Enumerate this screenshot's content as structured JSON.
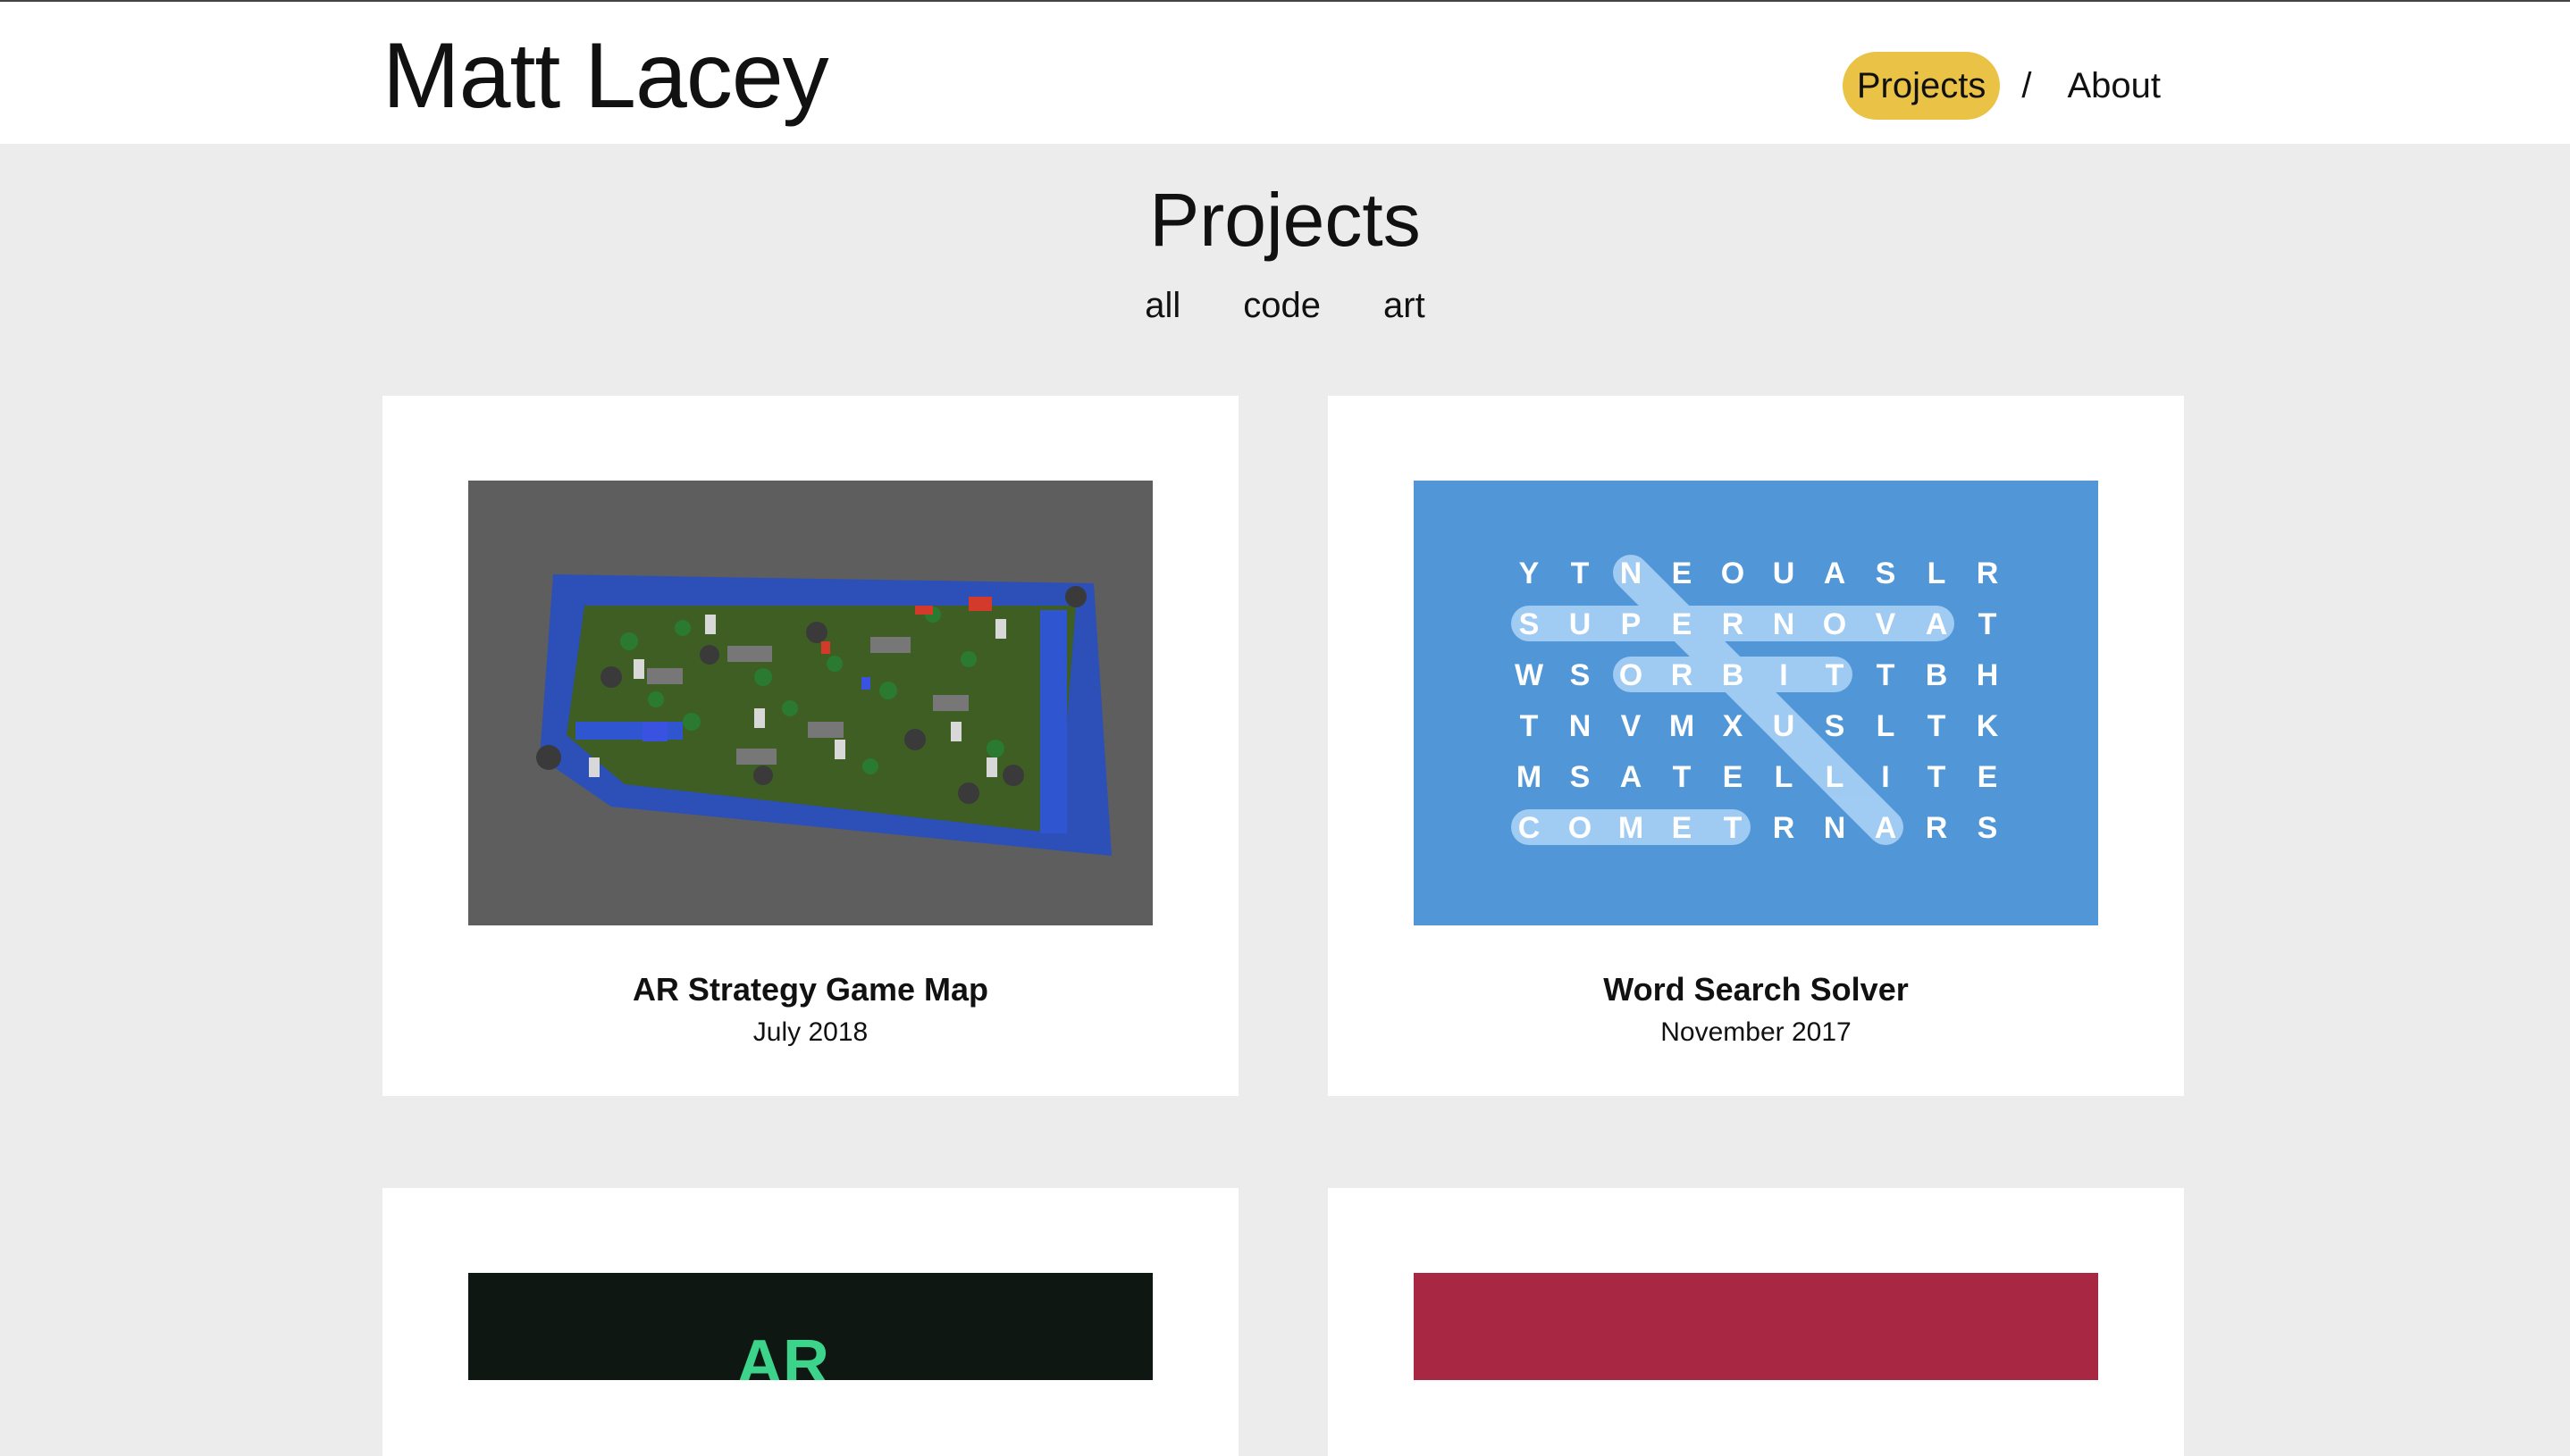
{
  "site": {
    "title": "Matt Lacey"
  },
  "nav": {
    "items": [
      {
        "label": "Projects",
        "active": true
      },
      {
        "label": "About",
        "active": false
      }
    ],
    "separator": "/"
  },
  "page": {
    "title": "Projects"
  },
  "filters": [
    "all",
    "code",
    "art"
  ],
  "projects": [
    {
      "title": "AR Strategy Game Map",
      "date": "July 2018",
      "thumb_icon": "ar-strategy-map-image"
    },
    {
      "title": "Word Search Solver",
      "date": "November 2017",
      "thumb_icon": "word-search-grid-image"
    },
    {
      "title": "",
      "date": "",
      "thumb_icon": "dark-ar-project-image",
      "thumb_text": "AR"
    },
    {
      "title": "",
      "date": "",
      "thumb_icon": "red-project-image"
    }
  ],
  "word_search": {
    "rows": [
      [
        "Y",
        "T",
        "N",
        "E",
        "O",
        "U",
        "A",
        "S",
        "L",
        "R"
      ],
      [
        "S",
        "U",
        "P",
        "E",
        "R",
        "N",
        "O",
        "V",
        "A",
        "T"
      ],
      [
        "W",
        "S",
        "O",
        "R",
        "B",
        "I",
        "T",
        "T",
        "B",
        "H"
      ],
      [
        "T",
        "N",
        "V",
        "M",
        "X",
        "U",
        "S",
        "L",
        "T",
        "K"
      ],
      [
        "M",
        "S",
        "A",
        "T",
        "E",
        "L",
        "L",
        "I",
        "T",
        "E"
      ],
      [
        "C",
        "O",
        "M",
        "E",
        "T",
        "R",
        "N",
        "A",
        "R",
        "S"
      ]
    ]
  },
  "colors": {
    "accent_nav": "#e9c246",
    "page_bg": "#ececec",
    "word_search_bg": "#5196d6",
    "highlight": "#a8d0f5"
  }
}
